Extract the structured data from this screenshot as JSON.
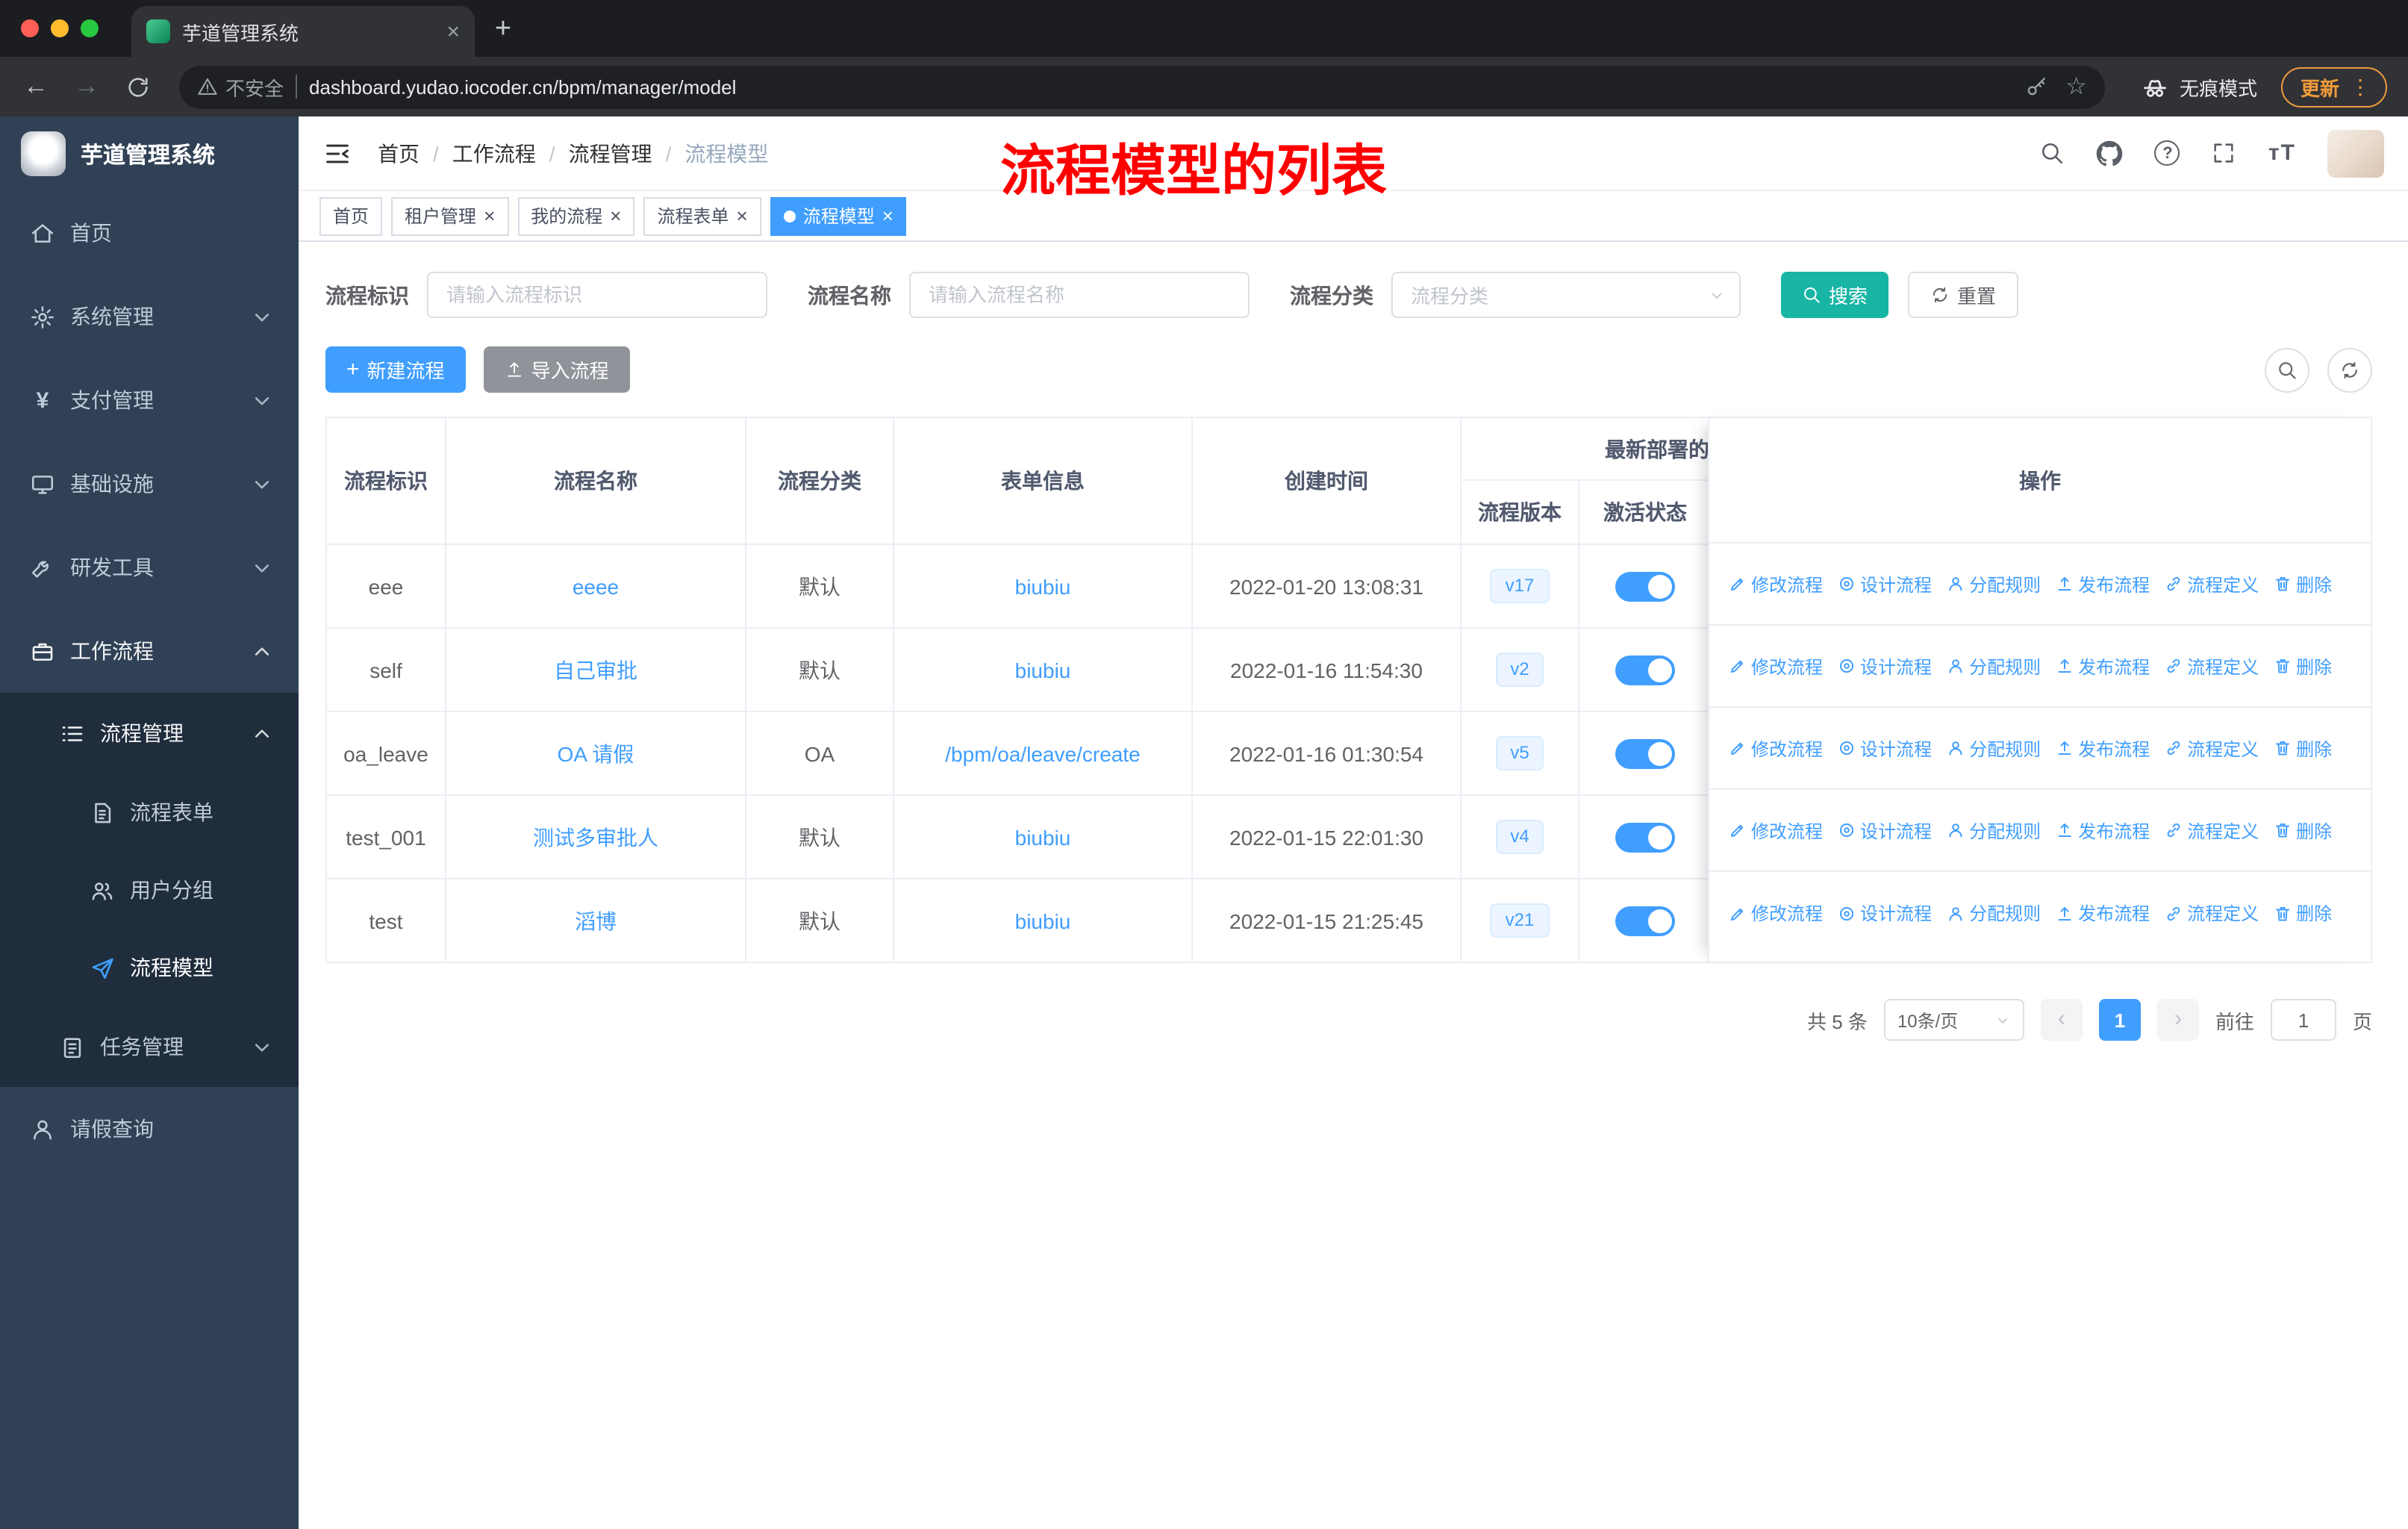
{
  "browser": {
    "tab_title": "芋道管理系统",
    "security_label": "不安全",
    "url": "dashboard.yudao.iocoder.cn/bpm/manager/model",
    "incognito_label": "无痕模式",
    "update_label": "更新"
  },
  "icons": {
    "back": "←",
    "forward": "→",
    "star": "☆",
    "menu_dots": "⋮",
    "close": "×",
    "plus": "+",
    "prev": "‹",
    "next": "›",
    "help": "?",
    "font_size": "тT",
    "yen": "¥"
  },
  "sidebar": {
    "logo": "芋道管理系统",
    "home": "首页",
    "system": "系统管理",
    "payment": "支付管理",
    "infra": "基础设施",
    "devtools": "研发工具",
    "workflow": "工作流程",
    "process_mgmt": "流程管理",
    "process_form": "流程表单",
    "user_group": "用户分组",
    "process_model": "流程模型",
    "task_mgmt": "任务管理",
    "leave_query": "请假查询"
  },
  "navbar": {
    "breadcrumb": [
      "首页",
      "工作流程",
      "流程管理",
      "流程模型"
    ]
  },
  "annotation": "流程模型的列表",
  "tags": [
    {
      "label": "首页",
      "active": false,
      "closable": false
    },
    {
      "label": "租户管理",
      "active": false,
      "closable": true
    },
    {
      "label": "我的流程",
      "active": false,
      "closable": true
    },
    {
      "label": "流程表单",
      "active": false,
      "closable": true
    },
    {
      "label": "流程模型",
      "active": true,
      "closable": true
    }
  ],
  "filter": {
    "id_label": "流程标识",
    "id_placeholder": "请输入流程标识",
    "name_label": "流程名称",
    "name_placeholder": "请输入流程名称",
    "category_label": "流程分类",
    "category_placeholder": "流程分类",
    "search_label": "搜索",
    "reset_label": "重置"
  },
  "actions": {
    "create_label": "新建流程",
    "import_label": "导入流程"
  },
  "table": {
    "columns": {
      "id": "流程标识",
      "name": "流程名称",
      "category": "流程分类",
      "form": "表单信息",
      "created": "创建时间",
      "deploy_group": "最新部署的",
      "version": "流程版本",
      "active": "激活状态",
      "ops": "操作"
    },
    "ops": [
      "修改流程",
      "设计流程",
      "分配规则",
      "发布流程",
      "流程定义",
      "删除"
    ],
    "rows": [
      {
        "id": "eee",
        "name": "eeee",
        "category": "默认",
        "form": "biubiu",
        "created": "2022-01-20 13:08:31",
        "version": "v17",
        "active": true
      },
      {
        "id": "self",
        "name": "自己审批",
        "category": "默认",
        "form": "biubiu",
        "created": "2022-01-16 11:54:30",
        "version": "v2",
        "active": true
      },
      {
        "id": "oa_leave",
        "name": "OA 请假",
        "category": "OA",
        "form": "/bpm/oa/leave/create",
        "created": "2022-01-16 01:30:54",
        "version": "v5",
        "active": true
      },
      {
        "id": "test_001",
        "name": "测试多审批人",
        "category": "默认",
        "form": "biubiu",
        "created": "2022-01-15 22:01:30",
        "version": "v4",
        "active": true
      },
      {
        "id": "test",
        "name": "滔博",
        "category": "默认",
        "form": "biubiu",
        "created": "2022-01-15 21:25:45",
        "version": "v21",
        "active": true
      }
    ]
  },
  "pagination": {
    "total": "共 5 条",
    "page_size": "10条/页",
    "current": "1",
    "goto_label": "前往",
    "goto_value": "1",
    "page_suffix": "页"
  },
  "colors": {
    "primary": "#409EFF",
    "search_button": "#18B5A5",
    "import_button": "#909399",
    "annotation_red": "#FF0000",
    "update_orange": "#ED9A3C",
    "sidebar_bg": "#304156",
    "submenu_bg": "#1F2D3D"
  }
}
